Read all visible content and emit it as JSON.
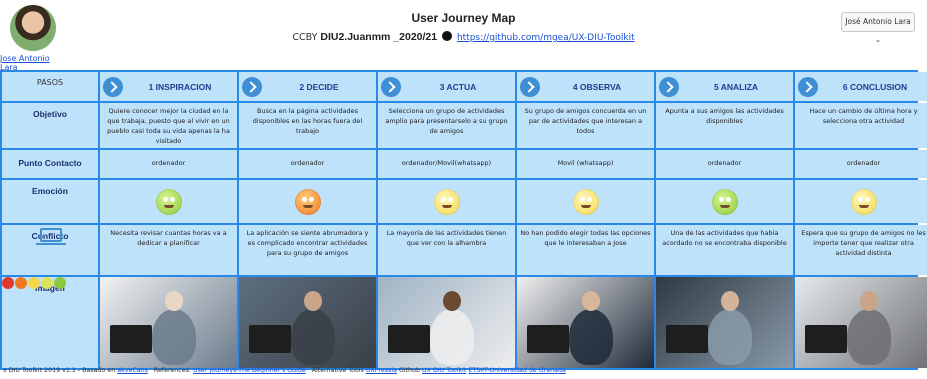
{
  "header": {
    "author_name": "Jose Antonio Lara",
    "title": "User Journey Map",
    "subtitle_prefix": "CCBY",
    "subtitle_id": "DIU2.Juanmm _2020/21",
    "subtitle_link": "https://github.com/mgea/UX-DIU-Toolkit",
    "user_menu": "José Antonio Lara ⌄"
  },
  "row_labels": {
    "pasos": "PASOS",
    "objetivo": "Objetivo",
    "punto": "Punto Contacto",
    "emocion": "Emoción",
    "conflicto": "Conflicto",
    "imagen": "Imagen"
  },
  "stages": [
    {
      "label": "1 INSPIRACION",
      "objetivo": "Quiere conocer mejor la ciudad en la que trabaja, puesto que al vivir en un pueblo casi toda su vida apenas la ha visitado",
      "punto": "ordenador",
      "emotion": "happy-green",
      "conflicto": "Necesita revisar cuantas horas va a dedicar a planificar",
      "image": "man-at-desktop-computer"
    },
    {
      "label": "2 DECIDE",
      "objetivo": "Busca en la página actividades disponibles en las horas fuera del trabajo",
      "punto": "ordenador",
      "emotion": "angry-orange",
      "conflicto": "La aplicación se siente abrumadora y es complicado encontrar actividades para su grupo de amigos",
      "image": "hands-typing-laptop"
    },
    {
      "label": "3 ACTUA",
      "objetivo": "Selecciona un grupo de actividades amplio para presentarselo a su grupo de amigos",
      "punto": "ordenador/Movil(whatsapp)",
      "emotion": "neutral-yellow",
      "conflicto": "La mayoría de las actividades tienen que ver con la alhambra",
      "image": "man-lying-with-phone"
    },
    {
      "label": "4 OBSERVA",
      "objetivo": "Su grupo de amigos concuerda en un par de actividades que interesan a todos",
      "punto": "Movil (whatsapp)",
      "emotion": "neutral-yellow",
      "conflicto": "No han podido elegir todas las opciones que le interesaban a Jose",
      "image": "man-suit-with-phone"
    },
    {
      "label": "5 ANALIZA",
      "objetivo": "Apunta a sus amigos las actividades disponibles",
      "punto": "ordenador",
      "emotion": "happy-green",
      "conflicto": "Una de las actividades que había acordado no se encontraba disponible",
      "image": "man-at-laptop"
    },
    {
      "label": "6 CONCLUSION",
      "objetivo": "Hace un cambio de última hora y selecciona otra actividad",
      "punto": "ordenador",
      "emotion": "neutral-yellow",
      "conflicto": "Espera que su grupo de amigos no les importe tener que realizar otra actividad distinta",
      "image": "tired-man-at-laptop"
    }
  ],
  "emotion_scale": [
    "angry-red",
    "annoyed-orange",
    "neutral-yellow",
    "content-yellow",
    "happy-green"
  ],
  "colors": {
    "accent": "#2a88e6",
    "cell": "#bfe2fb",
    "chevron": "#3f8fd4"
  },
  "footer": {
    "text1": "x DIU Toolkit 2019 v1.1 - Basado en",
    "link1": "akveCans",
    "text2": "References:",
    "link2": "User Journeys-The Beginner's Guide",
    "text3": "Alternative Tools",
    "link3": "UXPressia",
    "text4": "Github",
    "link4": "UX DIU Toolkit",
    "link5": "ETSIIT-Universidad de Granada"
  }
}
